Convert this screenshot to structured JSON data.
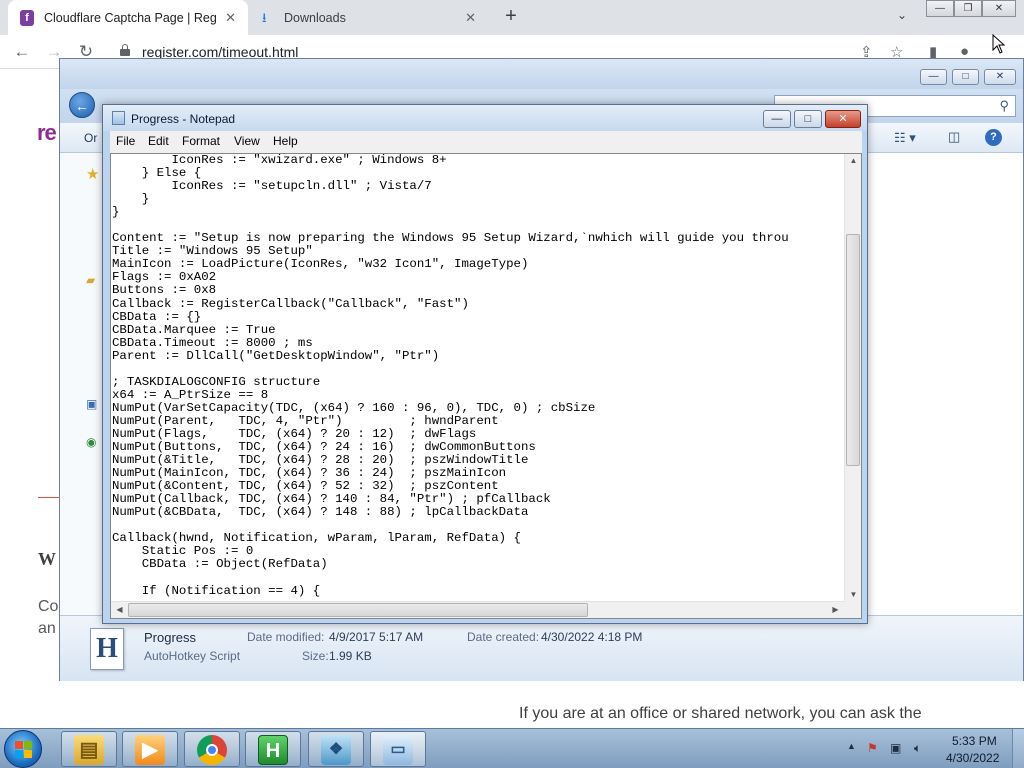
{
  "browser": {
    "tabs": [
      {
        "label": "Cloudflare Captcha Page | Regist",
        "active": true
      },
      {
        "label": "Downloads",
        "active": false
      }
    ],
    "url": "register.com/timeout.html",
    "new_tab_symbol": "+"
  },
  "site": {
    "logo_fragment": "re",
    "heading_fragment": "W",
    "para_fragment_1": "Co",
    "para_fragment_2": "an",
    "footer_text": "If you are at an office or shared network, you can ask the"
  },
  "explorer": {
    "organize_fragment": "Or"
  },
  "notepad": {
    "title": "Progress - Notepad",
    "menu": [
      "File",
      "Edit",
      "Format",
      "View",
      "Help"
    ],
    "lines": [
      "        IconRes := \"xwizard.exe\" ; Windows 8+",
      "    } Else {",
      "        IconRes := \"setupcln.dll\" ; Vista/7",
      "    }",
      "}",
      "",
      "Content := \"Setup is now preparing the Windows 95 Setup Wizard,`nwhich will guide you throu",
      "Title := \"Windows 95 Setup\"",
      "MainIcon := LoadPicture(IconRes, \"w32 Icon1\", ImageType)",
      "Flags := 0xA02",
      "Buttons := 0x8",
      "Callback := RegisterCallback(\"Callback\", \"Fast\")",
      "CBData := {}",
      "CBData.Marquee := True",
      "CBData.Timeout := 8000 ; ms",
      "Parent := DllCall(\"GetDesktopWindow\", \"Ptr\")",
      "",
      "; TASKDIALOGCONFIG structure",
      "x64 := A_PtrSize == 8",
      "NumPut(VarSetCapacity(TDC, (x64) ? 160 : 96, 0), TDC, 0) ; cbSize",
      "NumPut(Parent,   TDC, 4, \"Ptr\")         ; hwndParent",
      "NumPut(Flags,    TDC, (x64) ? 20 : 12)  ; dwFlags",
      "NumPut(Buttons,  TDC, (x64) ? 24 : 16)  ; dwCommonButtons",
      "NumPut(&Title,   TDC, (x64) ? 28 : 20)  ; pszWindowTitle",
      "NumPut(MainIcon, TDC, (x64) ? 36 : 24)  ; pszMainIcon",
      "NumPut(&Content, TDC, (x64) ? 52 : 32)  ; pszContent",
      "NumPut(Callback, TDC, (x64) ? 140 : 84, \"Ptr\") ; pfCallback",
      "NumPut(&CBData,  TDC, (x64) ? 148 : 88) ; lpCallbackData",
      "",
      "Callback(hwnd, Notification, wParam, lParam, RefData) {",
      "    Static Pos := 0",
      "    CBData := Object(RefData)",
      "",
      "    If (Notification == 4) {"
    ]
  },
  "details": {
    "name": "Progress",
    "type": "AutoHotkey Script",
    "modified_label": "Date modified:",
    "modified_value": "4/9/2017 5:17 AM",
    "created_label": "Date created:",
    "created_value": "4/30/2022 4:18 PM",
    "size_label": "Size:",
    "size_value": "1.99 KB"
  },
  "taskbar": {
    "time": "5:33 PM",
    "date": "4/30/2022"
  }
}
